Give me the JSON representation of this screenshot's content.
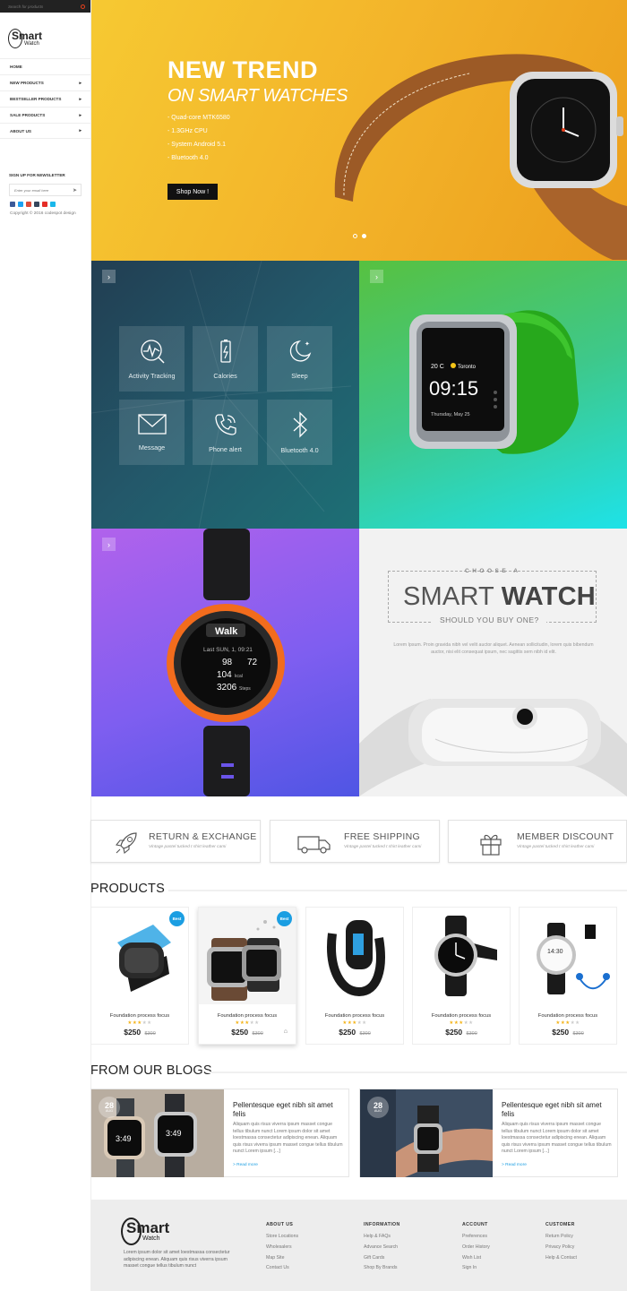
{
  "sidebar": {
    "search_placeholder": "Search for products",
    "logo_big": "Smart",
    "logo_small": "Watch",
    "nav": [
      {
        "label": "Home",
        "has_arrow": false
      },
      {
        "label": "New Products",
        "has_arrow": true
      },
      {
        "label": "Bestseller Products",
        "has_arrow": true
      },
      {
        "label": "Sale Products",
        "has_arrow": true
      },
      {
        "label": "About us",
        "has_arrow": true
      }
    ],
    "newsletter_title": "Sign up for newsletter",
    "newsletter_placeholder": "Enter your email here",
    "social_icons": [
      "facebook-icon",
      "twitter-icon",
      "google-plus-icon",
      "tumblr-icon",
      "youtube-icon",
      "vimeo-icon"
    ],
    "social_colors": [
      "#3b5998",
      "#1da1f2",
      "#dd4b39",
      "#35465c",
      "#e52d27",
      "#1ab7ea"
    ],
    "copyright": "Copyright © 2016 codespot design"
  },
  "hero": {
    "title": "NEW TREND",
    "subtitle": "ON SMART WATCHES",
    "specs": [
      "Quad-core MTK6580",
      "1.3GHz CPU",
      "System Android 5.1",
      "Bluetooth 4.0"
    ],
    "button": "Shop Now !",
    "slides_total": 2,
    "slide_active": 2
  },
  "features": [
    {
      "label": "Activity Tracking",
      "icon": "activity-icon"
    },
    {
      "label": "Calories",
      "icon": "battery-icon"
    },
    {
      "label": "Sleep",
      "icon": "moon-icon"
    },
    {
      "label": "Message",
      "icon": "envelope-icon"
    },
    {
      "label": "Phone alert",
      "icon": "phone-icon"
    },
    {
      "label": "Bluetooth 4.0",
      "icon": "bluetooth-icon"
    }
  ],
  "green_watch": {
    "date": "20 C",
    "city": "Toronto",
    "time": "09:15",
    "day": "Thursday, May 25"
  },
  "orange_watch": {
    "mode": "Walk",
    "last": "Last SUN, 1, 09:21",
    "hr_a": "98",
    "hr_b": "72",
    "kcal": "104",
    "kcal_unit": "kcal",
    "steps": "3206",
    "steps_unit": "Steps"
  },
  "choose": {
    "pre": "CHOOSE A",
    "title_a": "SMART",
    "title_b": "WATCH",
    "question": "SHOULD YOU BUY ONE?",
    "text": "Lorem Ipsum. Proin gravida nibh vel velit auctor aliquet. Aenean sollicitudin, lorem quis bibendum auctor, nisi elit consequat ipsum, nec sagittis sem nibh id elit."
  },
  "services": [
    {
      "title": "Return & Exchange",
      "sub": "Vintage pastel tucked t shirt leather cami",
      "icon": "rocket-icon"
    },
    {
      "title": "Free Shipping",
      "sub": "Vintage pastel tucked t shirt leather cami",
      "icon": "truck-icon"
    },
    {
      "title": "Member Discount",
      "sub": "Vintage pastel tucked t shirt leather cami",
      "icon": "gift-icon"
    }
  ],
  "products_title": "PRODUCTS",
  "products": [
    {
      "name": "Foundation process focus",
      "price": "$250",
      "old": "$300",
      "badge": "Best",
      "rating": 3
    },
    {
      "name": "Foundation process focus",
      "price": "$250",
      "old": "$300",
      "badge": "Best",
      "rating": 3
    },
    {
      "name": "Foundation process focus",
      "price": "$250",
      "old": "$300",
      "badge": "",
      "rating": 3
    },
    {
      "name": "Foundation process focus",
      "price": "$250",
      "old": "$300",
      "badge": "",
      "rating": 3
    },
    {
      "name": "Foundation process focus",
      "price": "$250",
      "old": "$300",
      "badge": "",
      "rating": 3
    }
  ],
  "product5_time": "14:30",
  "blogs_title": "FROM OUR BLOGS",
  "blogs": [
    {
      "day": "28",
      "month": "Aug",
      "title": "Pellentesque eget nibh sit amet felis",
      "excerpt": "Aliquam quis risus viverra ipsum masset congue tellus tibulum nunct Lorem ipsum dolor sit amet loestmassa consectetur adipiscing enean. Aliquam quis risus viverra ipsum masset congue tellus tibulum nunct Lorem ipsum [...]",
      "read": "> Read more",
      "clock1": "3:49",
      "clock2": "3:49"
    },
    {
      "day": "28",
      "month": "Aug",
      "title": "Pellentesque eget nibh sit amet felis",
      "excerpt": "Aliquam quis risus viverra ipsum masset congue tellus tibulum nunct Lorem ipsum dolor sit amet loestmassa consectetur adipiscing enean. Aliquam quis risus viverra ipsum masset congue tellus tibulum nunct Lorem ipsum [...]",
      "read": "> Read more"
    }
  ],
  "footer": {
    "logo_big": "Smart",
    "logo_small": "Watch",
    "desc": "Lorem ipsum dolor sit amet loestmassa consectetur adipiscing enean. Aliquam quis risus viverra ipsum masset congue tellus tibulum nunct",
    "columns": [
      {
        "title": "About us",
        "links": [
          "Store Locations",
          "Wholesalers",
          "Map Site",
          "Contact Us"
        ]
      },
      {
        "title": "Information",
        "links": [
          "Help & FAQs",
          "Advance Search",
          "Gift Cards",
          "Shop By Brands"
        ]
      },
      {
        "title": "Account",
        "links": [
          "Preferences",
          "Order History",
          "Wish List",
          "Sign In"
        ]
      },
      {
        "title": "Customer",
        "links": [
          "Return Policy",
          "Privacy Policy",
          "Help & Contact"
        ]
      }
    ]
  }
}
